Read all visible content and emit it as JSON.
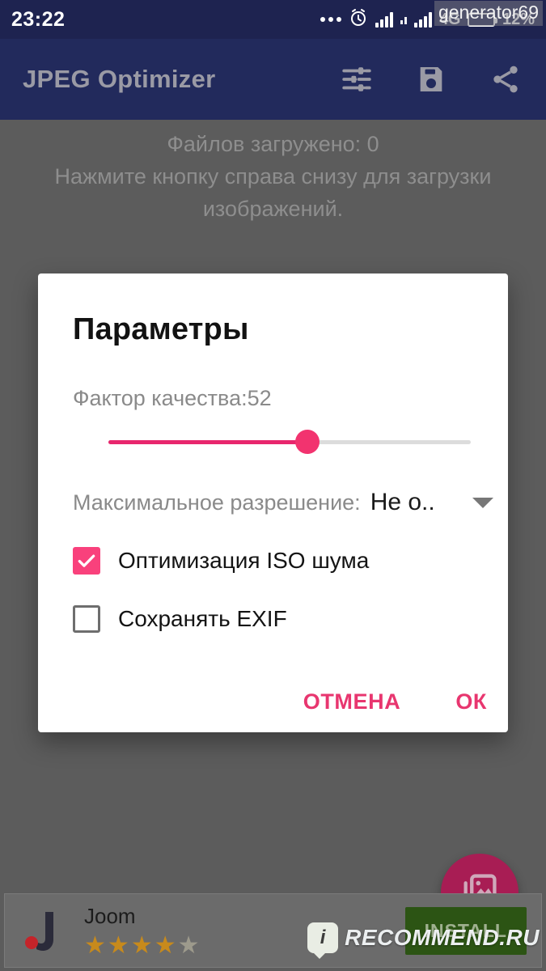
{
  "status_bar": {
    "clock": "23:22",
    "network_type": "4G",
    "battery_percent": "12%",
    "icons": [
      "more-dots-icon",
      "alarm-clock-icon",
      "signal-bars-icon",
      "signal-small-icon",
      "signal-bars-2-icon",
      "battery-icon"
    ]
  },
  "watermarks": {
    "top": "generator69",
    "bottom_badge": "i",
    "bottom": "RECOMMEND.RU"
  },
  "app_bar": {
    "title": "JPEG Optimizer",
    "actions": [
      {
        "name": "tune-icon",
        "label": "tune-icon"
      },
      {
        "name": "save-icon",
        "label": "save-icon"
      },
      {
        "name": "share-icon",
        "label": "share-icon"
      }
    ]
  },
  "main": {
    "files_loaded": "Файлов загружено: 0",
    "hint": "Нажмите кнопку справа снизу для загрузки изображений."
  },
  "dialog": {
    "title": "Параметры",
    "quality_label": "Фактор качества:52",
    "quality_value": 52,
    "quality_min": 0,
    "quality_max": 100,
    "resolution_label": "Максимальное разрешение:",
    "resolution_value": "Не о..",
    "checkboxes": [
      {
        "label": "Оптимизация ISO шума",
        "checked": true
      },
      {
        "label": "Сохранять EXIF",
        "checked": false
      }
    ],
    "cancel_label": "ОТМЕНА",
    "ok_label": "ОК"
  },
  "fab": {
    "icon": "photo-library-icon"
  },
  "ad": {
    "app_name": "Joom",
    "rating": 4.5,
    "stars": [
      "★",
      "★",
      "★",
      "★",
      "★"
    ],
    "install_label": "INSTALL"
  },
  "colors": {
    "status_bar": "#1e2350",
    "app_bar": "#222a5c",
    "scrim": "#5c5c5c",
    "accent_pink": "#f2336f",
    "accent_pink_dark": "#e8366f",
    "fab": "#a81d54",
    "install_green": "#2c5414",
    "star_gold": "#c78a1c"
  }
}
